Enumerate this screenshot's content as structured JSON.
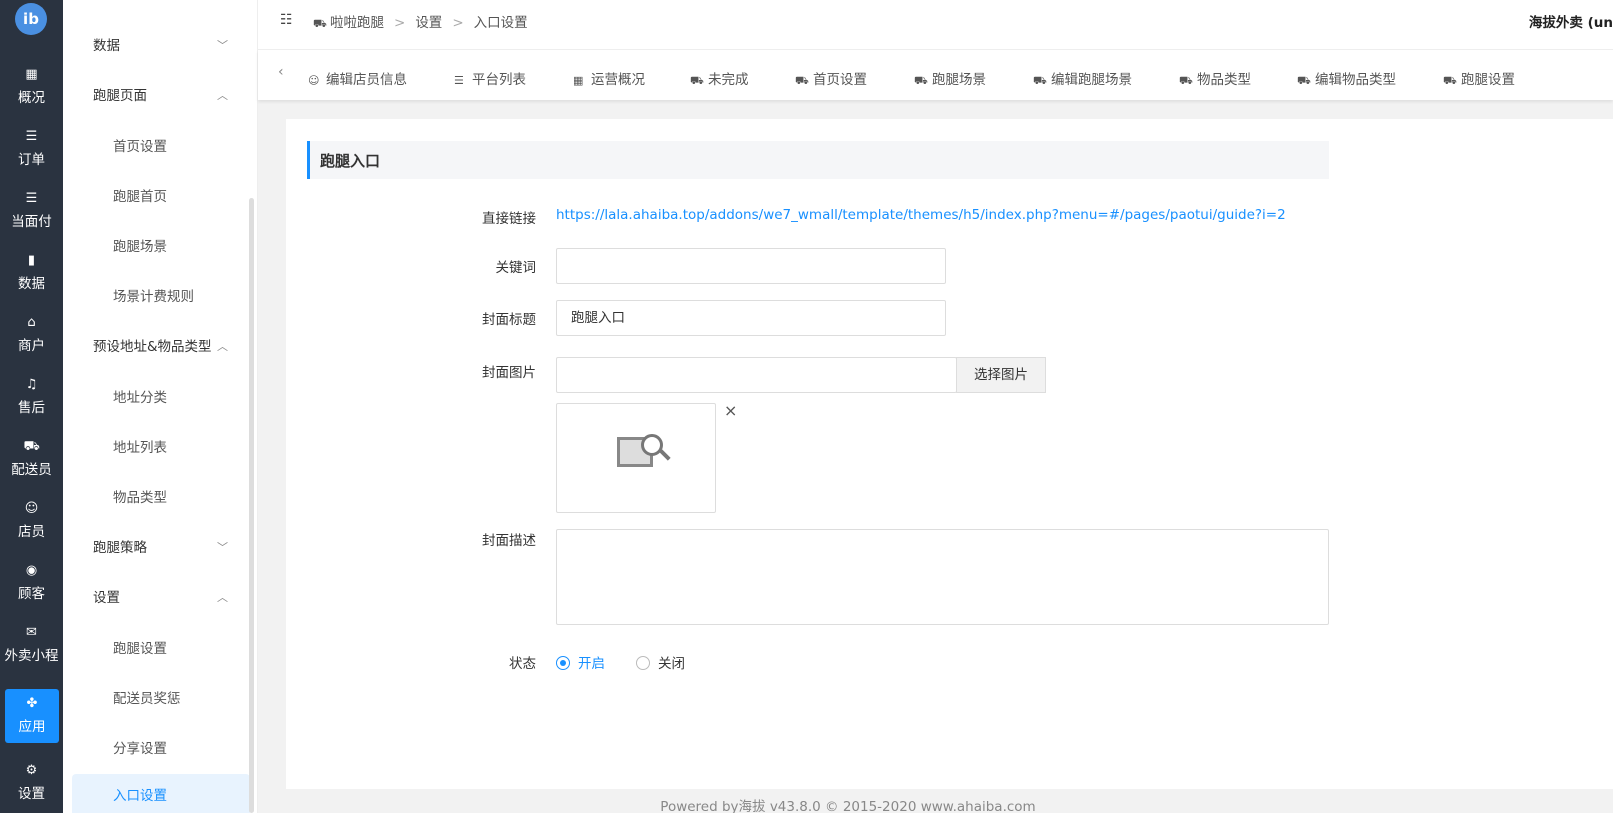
{
  "rail": {
    "items": [
      {
        "label": "概况",
        "icon": "grid-icon"
      },
      {
        "label": "订单",
        "icon": "list-icon"
      },
      {
        "label": "当面付",
        "icon": "list-icon"
      },
      {
        "label": "数据",
        "icon": "bar-chart-icon"
      },
      {
        "label": "商户",
        "icon": "store-icon"
      },
      {
        "label": "售后",
        "icon": "headset-icon"
      },
      {
        "label": "配送员",
        "icon": "scooter-icon"
      },
      {
        "label": "店员",
        "icon": "users-icon"
      },
      {
        "label": "顾客",
        "icon": "user-circle-icon"
      },
      {
        "label": "外卖小程",
        "icon": "wechat-icon"
      },
      {
        "label": "应用",
        "icon": "apps-icon"
      },
      {
        "label": "设置",
        "icon": "user-gear-icon"
      }
    ],
    "active": "应用"
  },
  "menu": {
    "groups": [
      {
        "label": "数据",
        "expanded": false
      },
      {
        "label": "跑腿页面",
        "expanded": true
      },
      {
        "label": "预设地址&物品类型",
        "expanded": true
      },
      {
        "label": "跑腿策略",
        "expanded": false
      },
      {
        "label": "设置",
        "expanded": true
      }
    ],
    "subs": [
      "首页设置",
      "跑腿首页",
      "跑腿场景",
      "场景计费规则",
      "地址分类",
      "地址列表",
      "物品类型",
      "跑腿设置",
      "配送员奖惩",
      "分享设置",
      "入口设置"
    ],
    "active": "入口设置"
  },
  "header": {
    "crumbs": [
      "啦啦跑腿",
      "设置",
      "入口设置"
    ],
    "sep": ">",
    "shop": "海拔外卖 (un"
  },
  "tabs": [
    "编辑店员信息",
    "平台列表",
    "运营概况",
    "未完成",
    "首页设置",
    "跑腿场景",
    "编辑跑腿场景",
    "物品类型",
    "编辑物品类型",
    "跑腿设置"
  ],
  "form": {
    "section_title": "跑腿入口",
    "link_label": "直接链接",
    "link": "https://lala.ahaiba.top/addons/we7_wmall/template/themes/h5/index.php?menu=#/pages/paotui/guide?i=2",
    "keyword_label": "关键词",
    "keyword_value": "",
    "cover_title_label": "封面标题",
    "cover_title_value": "跑腿入口",
    "cover_image_label": "封面图片",
    "cover_image_value": "",
    "pick_image": "选择图片",
    "close": "×",
    "cover_desc_label": "封面描述",
    "cover_desc_value": "",
    "status_label": "状态",
    "status_on": "开启",
    "status_off": "关闭",
    "status_value": "开启"
  },
  "footer": "Powered by海拔 v43.8.0 © 2015-2020 www.ahaiba.com"
}
